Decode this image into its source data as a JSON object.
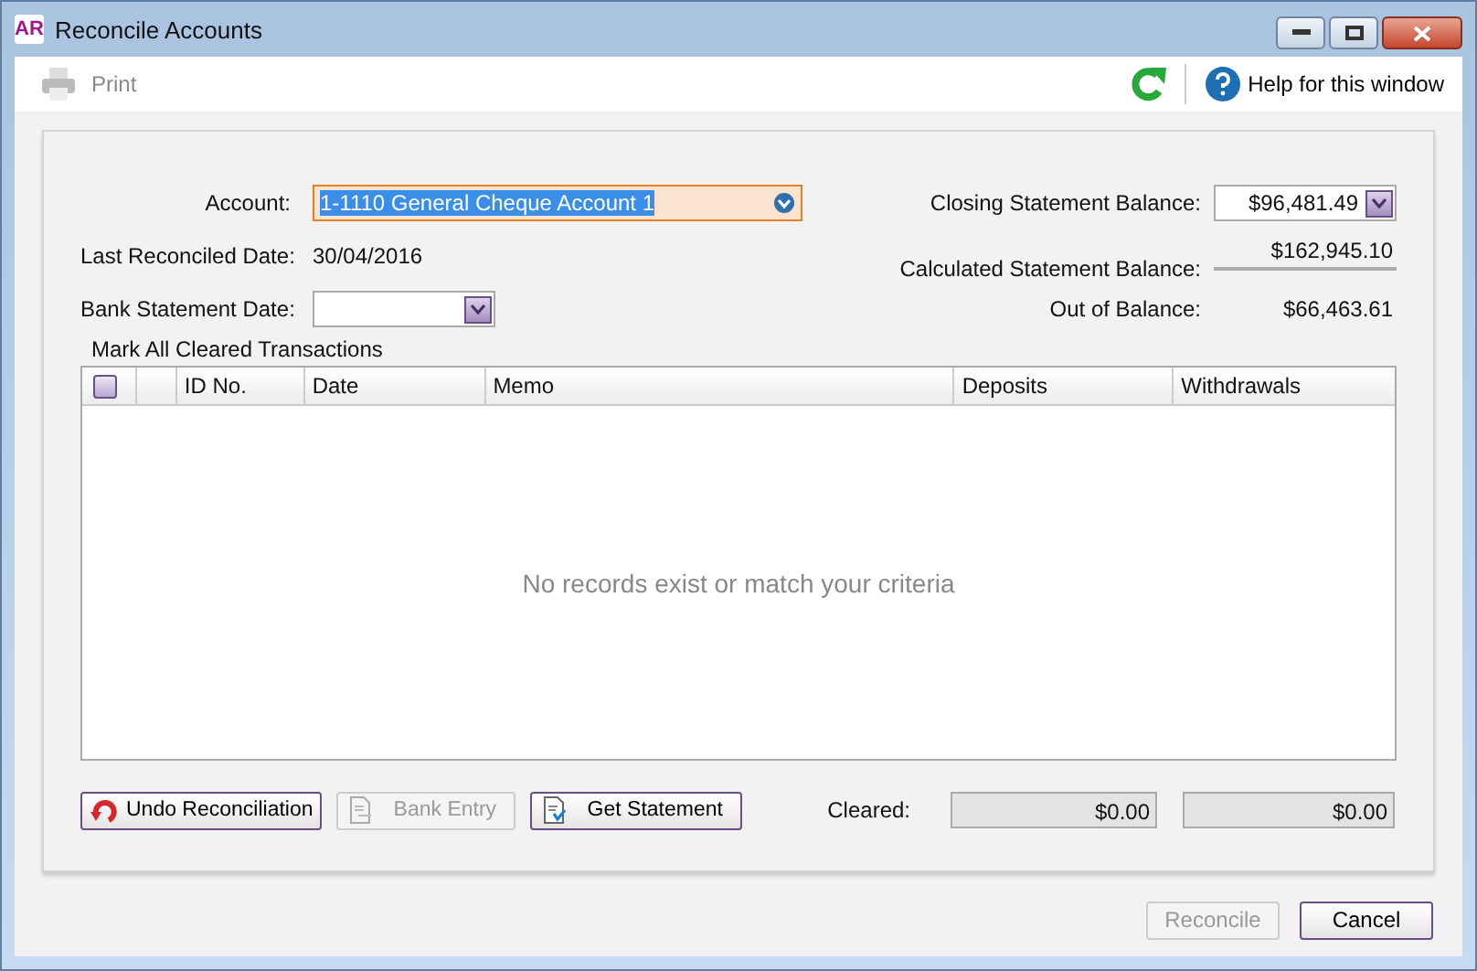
{
  "window": {
    "logo": "AR",
    "title": "Reconcile Accounts"
  },
  "toolbar": {
    "print": {
      "label": "Print",
      "disabled": true
    },
    "help": {
      "label": "Help for this window"
    }
  },
  "form": {
    "account": {
      "label": "Account:",
      "value": "1-1110 General Cheque Account 1",
      "selected": true
    },
    "last_reconciled": {
      "label": "Last Reconciled Date:",
      "value": "30/04/2016"
    },
    "bank_statement_date": {
      "label": "Bank Statement Date:"
    },
    "closing_balance": {
      "label": "Closing Statement Balance:",
      "value": "$96,481.49"
    },
    "calculated_balance": {
      "label": "Calculated Statement Balance:",
      "value": "$162,945.10"
    },
    "out_of_balance": {
      "label": "Out of Balance:",
      "value": "$66,463.61"
    }
  },
  "mark_all_label": "Mark All Cleared Transactions",
  "table": {
    "all_checked": false,
    "columns": [
      "",
      "ID No.",
      "Date",
      "Memo",
      "Deposits",
      "Withdrawals"
    ],
    "empty_message": "No records exist or match your criteria"
  },
  "actions": [
    {
      "label": "Undo Reconciliation",
      "kind": "undo",
      "disabled": false
    },
    {
      "label": "Bank Entry",
      "kind": "bank",
      "disabled": true
    },
    {
      "label": "Get Statement",
      "kind": "statement",
      "disabled": false
    }
  ],
  "cleared": {
    "label": "Cleared:",
    "deposits": "$0.00",
    "withdrawals": "$0.00"
  },
  "footer": [
    {
      "label": "Reconcile",
      "disabled": true
    },
    {
      "label": "Cancel",
      "disabled": false
    }
  ]
}
